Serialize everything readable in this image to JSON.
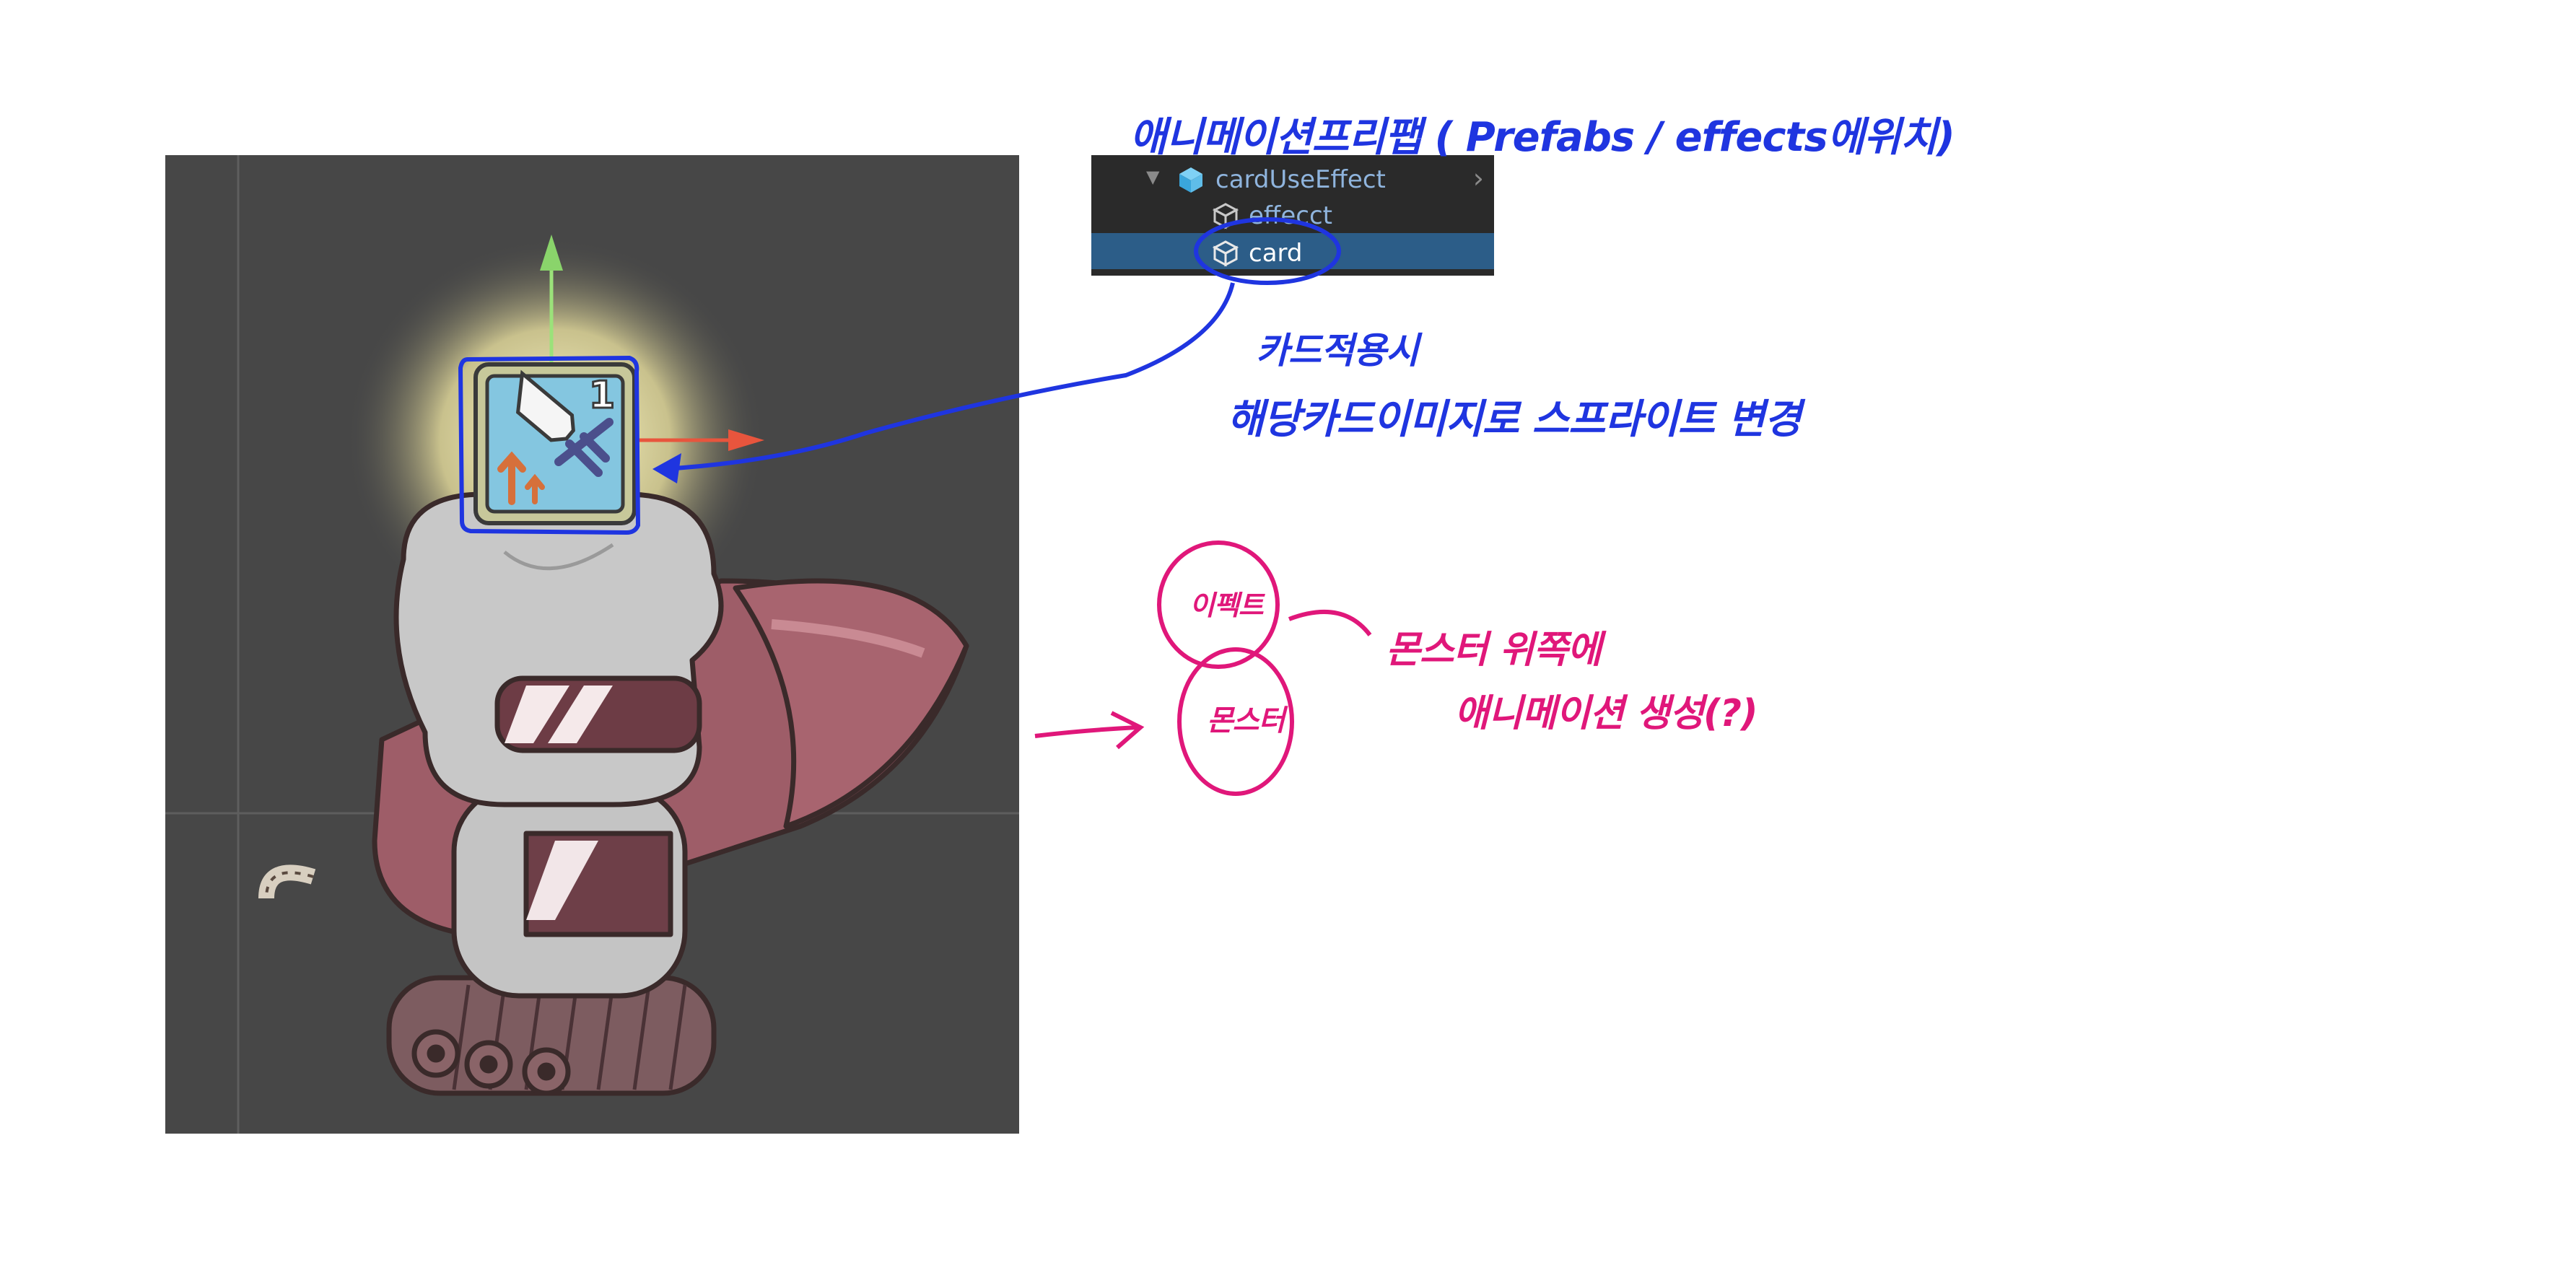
{
  "annotations": {
    "title": "애니메이션프리팹 ( Prefabs / effects에위치)",
    "card_note_line1": "카드적용시",
    "card_note_line2": "해당카드이미지로 스프라이트 변경",
    "effect_label": "이펙트",
    "monster_label": "몬스터",
    "monster_note_line1": "몬스터 위쪽에",
    "monster_note_line2": "애니메이션 생성(?)"
  },
  "hierarchy": {
    "rows": [
      {
        "label": "cardUseEffect",
        "icon": "prefab-cube-icon",
        "expanded": true
      },
      {
        "label": "effecct",
        "icon": "gameobject-cube-icon"
      },
      {
        "label": "card",
        "icon": "gameobject-cube-icon",
        "selected": true
      }
    ]
  },
  "scene": {
    "card_cost": "1"
  },
  "colors": {
    "annotation_blue": "#1f35e0",
    "annotation_pink": "#e0177a",
    "scene_bg": "#474747",
    "selection": "#2c5d88"
  }
}
